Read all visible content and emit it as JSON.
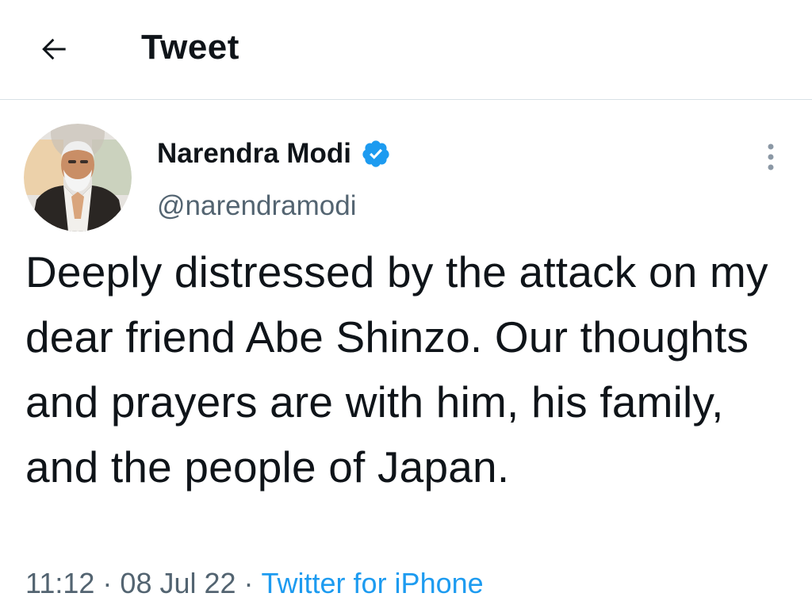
{
  "header": {
    "title": "Tweet",
    "back_icon": "arrow-left-icon"
  },
  "tweet": {
    "author": {
      "display_name": "Narendra Modi",
      "handle": "@narendramodi",
      "verified": true,
      "verified_icon": "verified-badge-icon",
      "verified_color": "#1d9bf0"
    },
    "more_icon": "more-vertical-icon",
    "text": "Deeply distressed by the attack on my dear friend Abe Shinzo. Our thoughts and prayers are with him, his family, and the people of Japan.",
    "time": "11:12",
    "date": "08 Jul 22",
    "separator": "·",
    "source": "Twitter for iPhone"
  },
  "colors": {
    "text_primary": "#0f1419",
    "text_secondary": "#536471",
    "link": "#1d9bf0",
    "divider": "#d8e1e6"
  }
}
